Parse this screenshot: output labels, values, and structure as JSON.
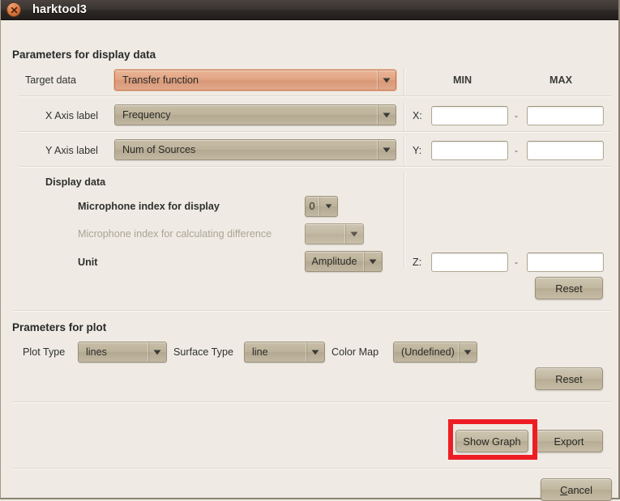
{
  "window": {
    "title": "harktool3",
    "close_icon": "close-icon"
  },
  "sections": {
    "display_data_title": "Parameters for display data",
    "plot_title": "Prameters for plot"
  },
  "columns": {
    "min_header": "MIN",
    "max_header": "MAX"
  },
  "rows": {
    "target_data": {
      "label": "Target data",
      "value": "Transfer function"
    },
    "x_axis": {
      "label": "X Axis label",
      "value": "Frequency",
      "range_prefix": "X:",
      "min_value": "",
      "max_value": "",
      "separator": "-"
    },
    "y_axis": {
      "label": "Y Axis label",
      "value": "Num of Sources",
      "range_prefix": "Y:",
      "min_value": "",
      "max_value": "",
      "separator": "-"
    },
    "display_data": {
      "label": "Display data"
    },
    "mic_display": {
      "label": "Microphone index for display",
      "value": "0"
    },
    "mic_difference": {
      "label": "Microphone index for calculating difference",
      "value": ""
    },
    "unit": {
      "label": "Unit",
      "value": "Amplitude",
      "range_prefix": "Z:",
      "min_value": "",
      "max_value": "",
      "separator": "-"
    }
  },
  "plot": {
    "plot_type_label": "Plot Type",
    "plot_type_value": "lines",
    "surface_type_label": "Surface Type",
    "surface_type_value": "line",
    "color_map_label": "Color Map",
    "color_map_value": "(Undefined)"
  },
  "buttons": {
    "reset_display": "Reset",
    "reset_plot": "Reset",
    "show_graph": "Show Graph",
    "export": "Export",
    "cancel_mnemonic": "C",
    "cancel_rest": "ancel"
  },
  "placeholders": {
    "empty": ""
  },
  "colors": {
    "accent_highlight": "#e2a584",
    "annotation": "#ee1d24",
    "window_bg": "#efebe4",
    "titlebar": "#2e2a27",
    "widget_face": "#bdb29a"
  }
}
